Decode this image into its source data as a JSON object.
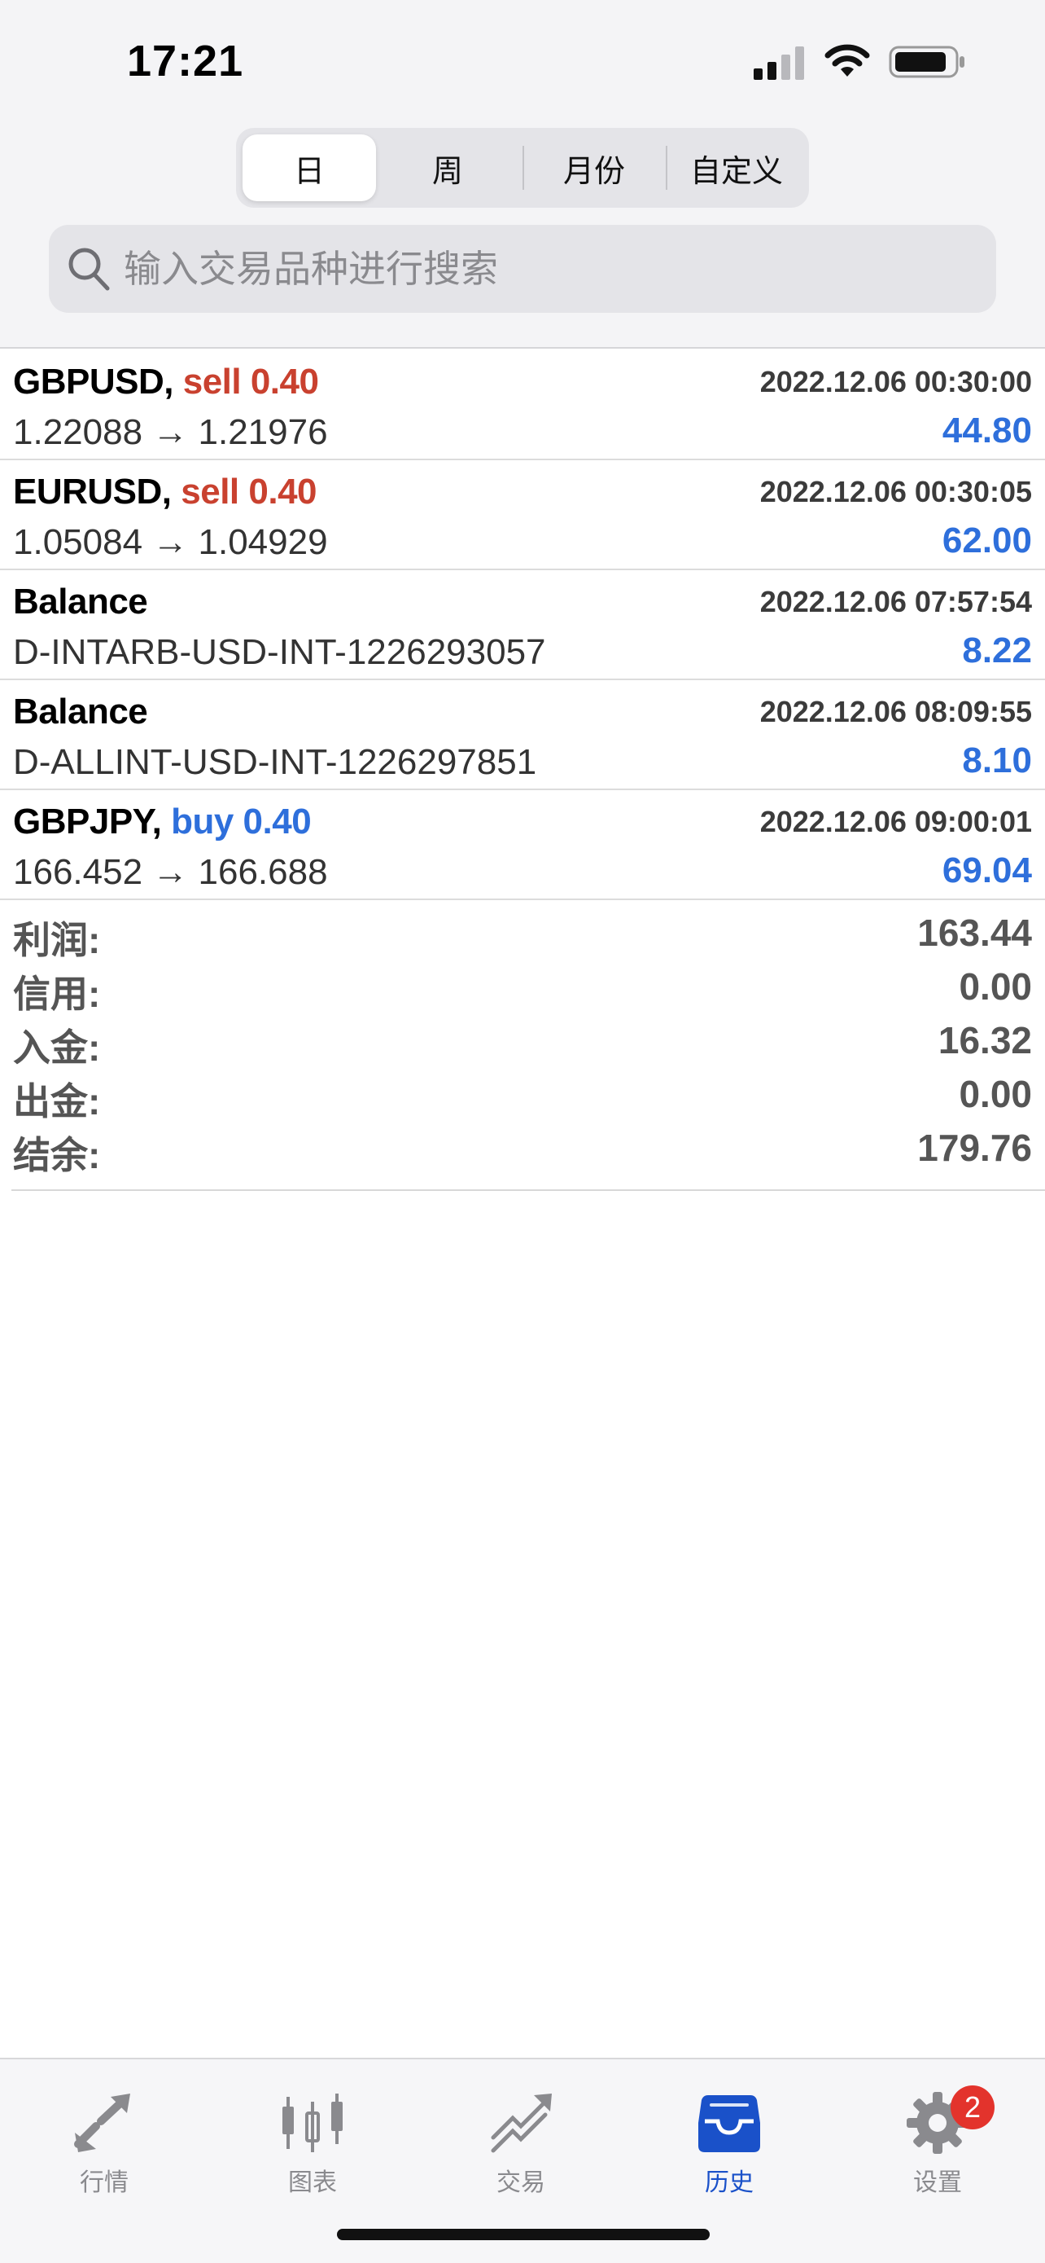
{
  "status_bar": {
    "time": "17:21"
  },
  "period_tabs": [
    {
      "label": "日",
      "active": true
    },
    {
      "label": "周",
      "active": false
    },
    {
      "label": "月份",
      "active": false
    },
    {
      "label": "自定义",
      "active": false
    }
  ],
  "search": {
    "placeholder": "输入交易品种进行搜索"
  },
  "deals": [
    {
      "symbol": "GBPUSD,",
      "action": "sell 0.40",
      "action_type": "sell",
      "time": "2022.12.06 00:30:00",
      "detail": "1.22088 → 1.21976",
      "profit": "44.80"
    },
    {
      "symbol": "EURUSD,",
      "action": "sell 0.40",
      "action_type": "sell",
      "time": "2022.12.06 00:30:05",
      "detail": "1.05084 → 1.04929",
      "profit": "62.00"
    },
    {
      "symbol": "Balance",
      "action": "",
      "action_type": "none",
      "time": "2022.12.06 07:57:54",
      "detail": "D-INTARB-USD-INT-1226293057",
      "profit": "8.22"
    },
    {
      "symbol": "Balance",
      "action": "",
      "action_type": "none",
      "time": "2022.12.06 08:09:55",
      "detail": "D-ALLINT-USD-INT-1226297851",
      "profit": "8.10"
    },
    {
      "symbol": "GBPJPY,",
      "action": "buy 0.40",
      "action_type": "buy",
      "time": "2022.12.06 09:00:01",
      "detail": "166.452 → 166.688",
      "profit": "69.04"
    }
  ],
  "summary": [
    {
      "label": "利润:",
      "value": "163.44"
    },
    {
      "label": "信用:",
      "value": "0.00"
    },
    {
      "label": "入金:",
      "value": "16.32"
    },
    {
      "label": "出金:",
      "value": "0.00"
    },
    {
      "label": "结余:",
      "value": "179.76"
    }
  ],
  "tab_bar": [
    {
      "label": "行情",
      "icon": "quotes-arrows-icon",
      "active": false
    },
    {
      "label": "图表",
      "icon": "candlestick-chart-icon",
      "active": false
    },
    {
      "label": "交易",
      "icon": "trade-trend-icon",
      "active": false
    },
    {
      "label": "历史",
      "icon": "history-inbox-icon",
      "active": true
    },
    {
      "label": "设置",
      "icon": "gear-icon",
      "active": false,
      "badge": "2"
    }
  ],
  "colors": {
    "sell": "#c9412f",
    "buy": "#2e6fdb",
    "profit": "#2e6fdb",
    "active_tab": "#1a51c9",
    "badge": "#e3332c"
  }
}
